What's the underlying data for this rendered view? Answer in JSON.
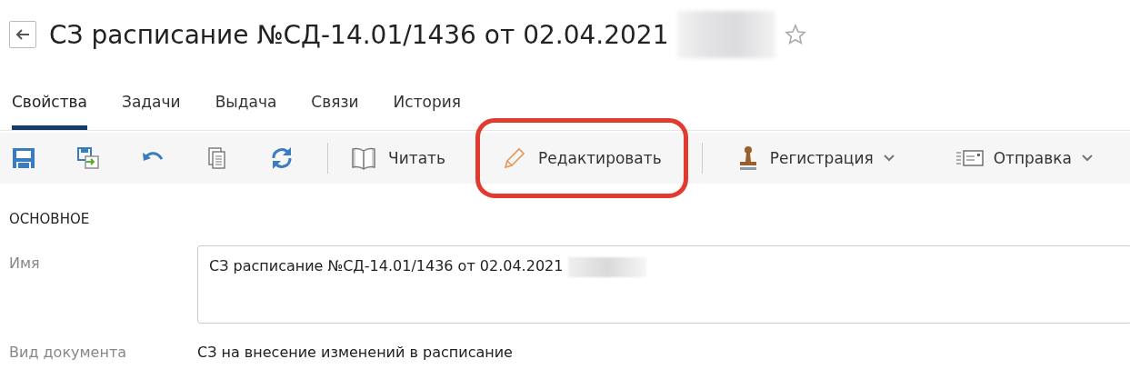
{
  "header": {
    "title": "СЗ расписание №СД-14.01/1436 от 02.04.2021",
    "favorite": false
  },
  "tabs": [
    {
      "label": "Свойства",
      "selected": true
    },
    {
      "label": "Задачи",
      "selected": false
    },
    {
      "label": "Выдача",
      "selected": false
    },
    {
      "label": "Связи",
      "selected": false
    },
    {
      "label": "История",
      "selected": false
    }
  ],
  "toolbar": [
    {
      "kind": "icon"
    },
    {
      "kind": "icon"
    },
    {
      "kind": "icon"
    },
    {
      "kind": "icon"
    },
    {
      "kind": "icon"
    },
    {
      "kind": "separator"
    },
    {
      "kind": "button",
      "label": "Читать",
      "highlighted": false
    },
    {
      "kind": "button",
      "label": "Редактировать",
      "highlighted": true
    },
    {
      "kind": "separator"
    },
    {
      "kind": "dropdown",
      "label": "Регистрация"
    },
    {
      "kind": "dropdown",
      "label": "Отправка"
    }
  ],
  "section": {
    "heading": "ОСНОВНОЕ",
    "fields": [
      {
        "kind": "textarea",
        "label": "Имя",
        "value": "СЗ расписание №СД-14.01/1436 от 02.04.2021"
      },
      {
        "kind": "text",
        "label": "Вид документа",
        "value": "СЗ на внесение изменений в расписание"
      }
    ]
  }
}
